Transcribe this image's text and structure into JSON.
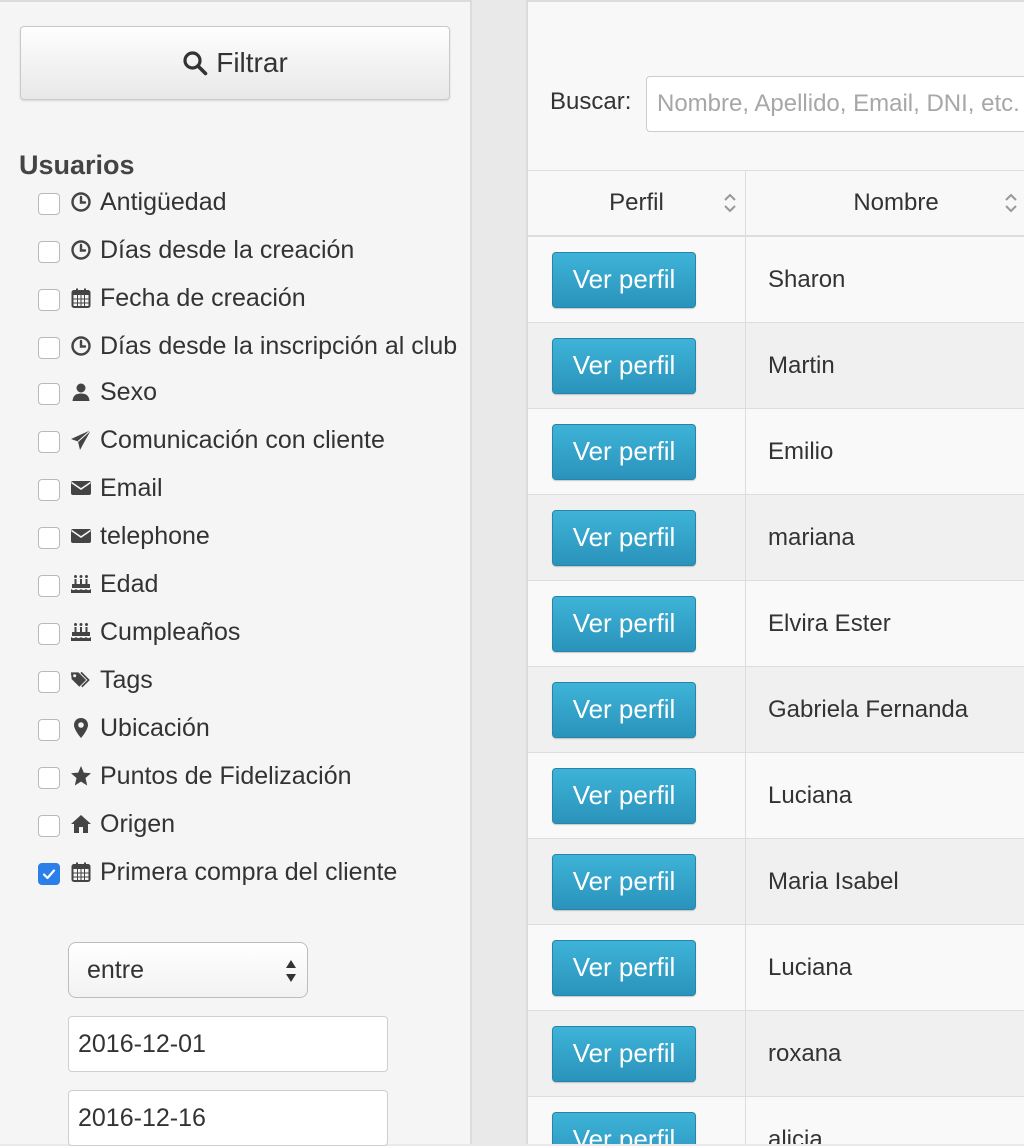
{
  "filter_button": {
    "label": "Filtrar",
    "icon": "search-icon"
  },
  "sidebar": {
    "section_title": "Usuarios",
    "filters": [
      {
        "label": "Antigüedad",
        "icon": "clock-icon",
        "checked": false
      },
      {
        "label": "Días desde la creación",
        "icon": "clock-icon",
        "checked": false
      },
      {
        "label": "Fecha de creación",
        "icon": "calendar-icon",
        "checked": false
      },
      {
        "label": "Días desde la inscripción al club",
        "icon": "clock-icon",
        "checked": false
      },
      {
        "label": "Sexo",
        "icon": "user-icon",
        "checked": false
      },
      {
        "label": "Comunicación con cliente",
        "icon": "paper-plane-icon",
        "checked": false
      },
      {
        "label": "Email",
        "icon": "envelope-icon",
        "checked": false
      },
      {
        "label": "telephone",
        "icon": "envelope-icon",
        "checked": false
      },
      {
        "label": "Edad",
        "icon": "birthday-cake-icon",
        "checked": false
      },
      {
        "label": "Cumpleaños",
        "icon": "birthday-cake-icon",
        "checked": false
      },
      {
        "label": "Tags",
        "icon": "tags-icon",
        "checked": false
      },
      {
        "label": "Ubicación",
        "icon": "map-marker-icon",
        "checked": false
      },
      {
        "label": "Puntos de Fidelización",
        "icon": "star-icon",
        "checked": false
      },
      {
        "label": "Origen",
        "icon": "home-icon",
        "checked": false
      },
      {
        "label": "Primera compra del cliente",
        "icon": "calendar-icon",
        "checked": true
      }
    ],
    "range_select": {
      "value": "entre"
    },
    "date_from": "2016-12-01",
    "date_to": "2016-12-16"
  },
  "search": {
    "label": "Buscar:",
    "placeholder": "Nombre, Apellido, Email, DNI, etc."
  },
  "table": {
    "columns": [
      "Perfil",
      "Nombre"
    ],
    "button_label": "Ver perfil",
    "rows": [
      {
        "nombre": "Sharon"
      },
      {
        "nombre": "Martin"
      },
      {
        "nombre": "Emilio"
      },
      {
        "nombre": "mariana"
      },
      {
        "nombre": "Elvira Ester"
      },
      {
        "nombre": "Gabriela Fernanda"
      },
      {
        "nombre": "Luciana"
      },
      {
        "nombre": "Maria Isabel"
      },
      {
        "nombre": "Luciana"
      },
      {
        "nombre": "roxana"
      },
      {
        "nombre": "alicia"
      }
    ]
  },
  "colors": {
    "accent_button": "#2f9fc8",
    "checkbox_checked": "#2a7fe8"
  }
}
